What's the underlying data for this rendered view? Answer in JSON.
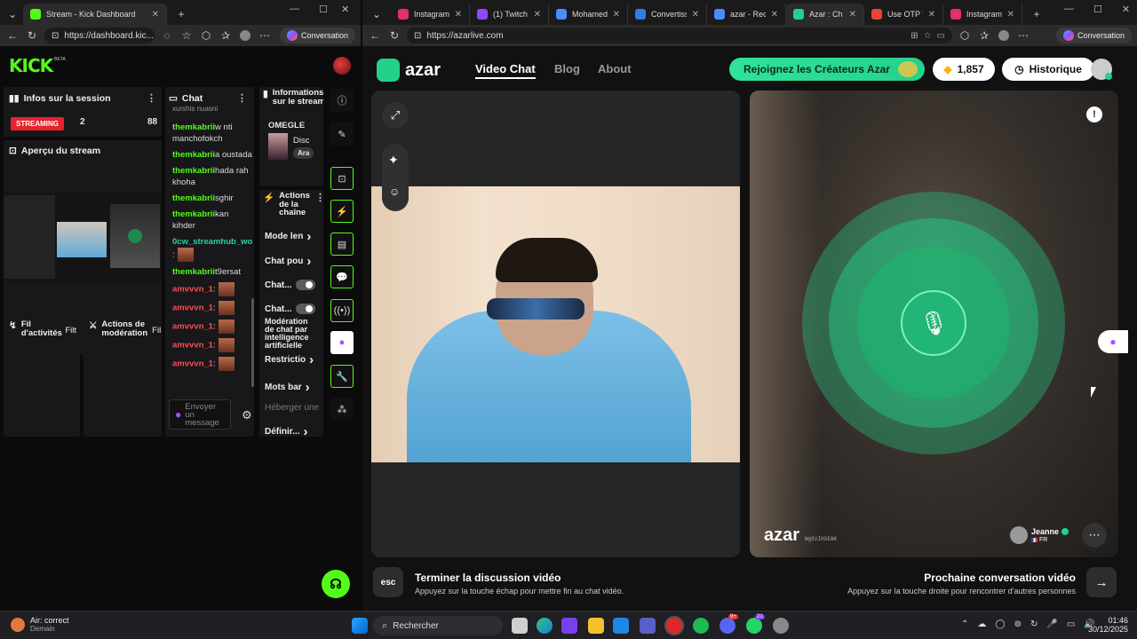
{
  "left_window": {
    "tab_title": "Stream - Kick Dashboard",
    "url": "https://dashboard.kic...",
    "conversation_label": "Conversation"
  },
  "right_window": {
    "tabs": [
      {
        "label": "Instagram",
        "color": "#e1306c"
      },
      {
        "label": "(1) Twitch",
        "color": "#9146ff"
      },
      {
        "label": "Mohamed Ra",
        "color": "#4a8cff"
      },
      {
        "label": "Convertisseur",
        "color": "#2f7de1"
      },
      {
        "label": "azar - Recher",
        "color": "#4a8cff"
      },
      {
        "label": "Azar : Ch",
        "color": "#23d18b"
      },
      {
        "label": "Use OTP To P",
        "color": "#ea4335"
      },
      {
        "label": "Instagram",
        "color": "#e1306c"
      }
    ],
    "url": "https://azarlive.com",
    "conversation_label": "Conversation"
  },
  "kick": {
    "logo": "KICK",
    "logo_beta": "BETA",
    "session": {
      "title": "Infos sur la session",
      "status": "STREAMING",
      "viewers": "2",
      "followers": "88"
    },
    "preview": {
      "title": "Aperçu du stream"
    },
    "chat": {
      "title": "Chat",
      "partial_top": "xurshis nuasni",
      "messages": [
        {
          "user": "themkabrii",
          "text": "w nti manchofokch",
          "color": "green"
        },
        {
          "user": "themkabrii",
          "text": "a oustada",
          "color": "green"
        },
        {
          "user": "themkabrii",
          "text": "hada rah khoha",
          "color": "green"
        },
        {
          "user": "themkabrii",
          "text": "sghir",
          "color": "green"
        },
        {
          "user": "themkabrii",
          "text": "kan kihder",
          "color": "green"
        },
        {
          "user": "0cw_streamhub_world",
          "text": ":",
          "color": "green"
        },
        {
          "user": "themkabrii",
          "text": "t9ersat",
          "color": "green"
        },
        {
          "user": "amvvvn_1",
          "text": ":",
          "color": "red"
        },
        {
          "user": "amvvvn_1",
          "text": ":",
          "color": "red"
        },
        {
          "user": "amvvvn_1",
          "text": ":",
          "color": "red"
        },
        {
          "user": "amvvvn_1",
          "text": ":",
          "color": "red"
        },
        {
          "user": "amvvvn_1",
          "text": ":",
          "color": "red"
        }
      ],
      "input_placeholder": "Envoyer un message"
    },
    "info": {
      "title": "Informations sur le stream",
      "category": "OMEGLE",
      "game_title": "Disc",
      "tag": "Ara"
    },
    "actions": {
      "title": "Actions de la chaîne",
      "items": [
        {
          "label": "Mode len",
          "kind": "chevron"
        },
        {
          "label": "Chat pou",
          "kind": "chevron"
        },
        {
          "label": "Chat...",
          "kind": "toggle"
        },
        {
          "label": "Chat...",
          "kind": "toggle"
        },
        {
          "label": "Modération de chat par intelligence artificielle",
          "kind": "ai"
        },
        {
          "label": "Restrictio",
          "kind": "chevron"
        },
        {
          "label": "Mots bar",
          "kind": "chevron"
        },
        {
          "label": "Héberger une",
          "kind": "disabled"
        },
        {
          "label": "Définir...",
          "kind": "chevron"
        }
      ]
    },
    "activity": {
      "title": "Fil d'activités",
      "filter": "Filt"
    },
    "moderation": {
      "title": "Actions de modération",
      "filter": "Fil"
    }
  },
  "azar": {
    "logo": "azar",
    "nav": [
      "Video Chat",
      "Blog",
      "About"
    ],
    "creators_button": "Rejoignez les Créateurs Azar",
    "gems": "1,857",
    "history": "Historique",
    "partner": {
      "name": "Jeanne",
      "country": "FR",
      "watermark_id": "Wg9zIHXEAK"
    },
    "end": {
      "key": "esc",
      "title": "Terminer la discussion vidéo",
      "hint": "Appuyez sur la touche échap pour mettre fin au chat vidéo."
    },
    "next": {
      "title": "Prochaine conversation vidéo",
      "hint": "Appuyez sur la touche droite pour rencontrer d'autres personnes"
    }
  },
  "taskbar": {
    "weather_line1": "Air: correct",
    "weather_line2": "Demain",
    "search": "Rechercher",
    "time": "01:46",
    "date": "30/12/2025",
    "badges": [
      "9+",
      "21"
    ]
  },
  "colors": {
    "kick_green": "#53fc18",
    "azar_green": "#23d18b",
    "streaming_red": "#e8222d"
  }
}
